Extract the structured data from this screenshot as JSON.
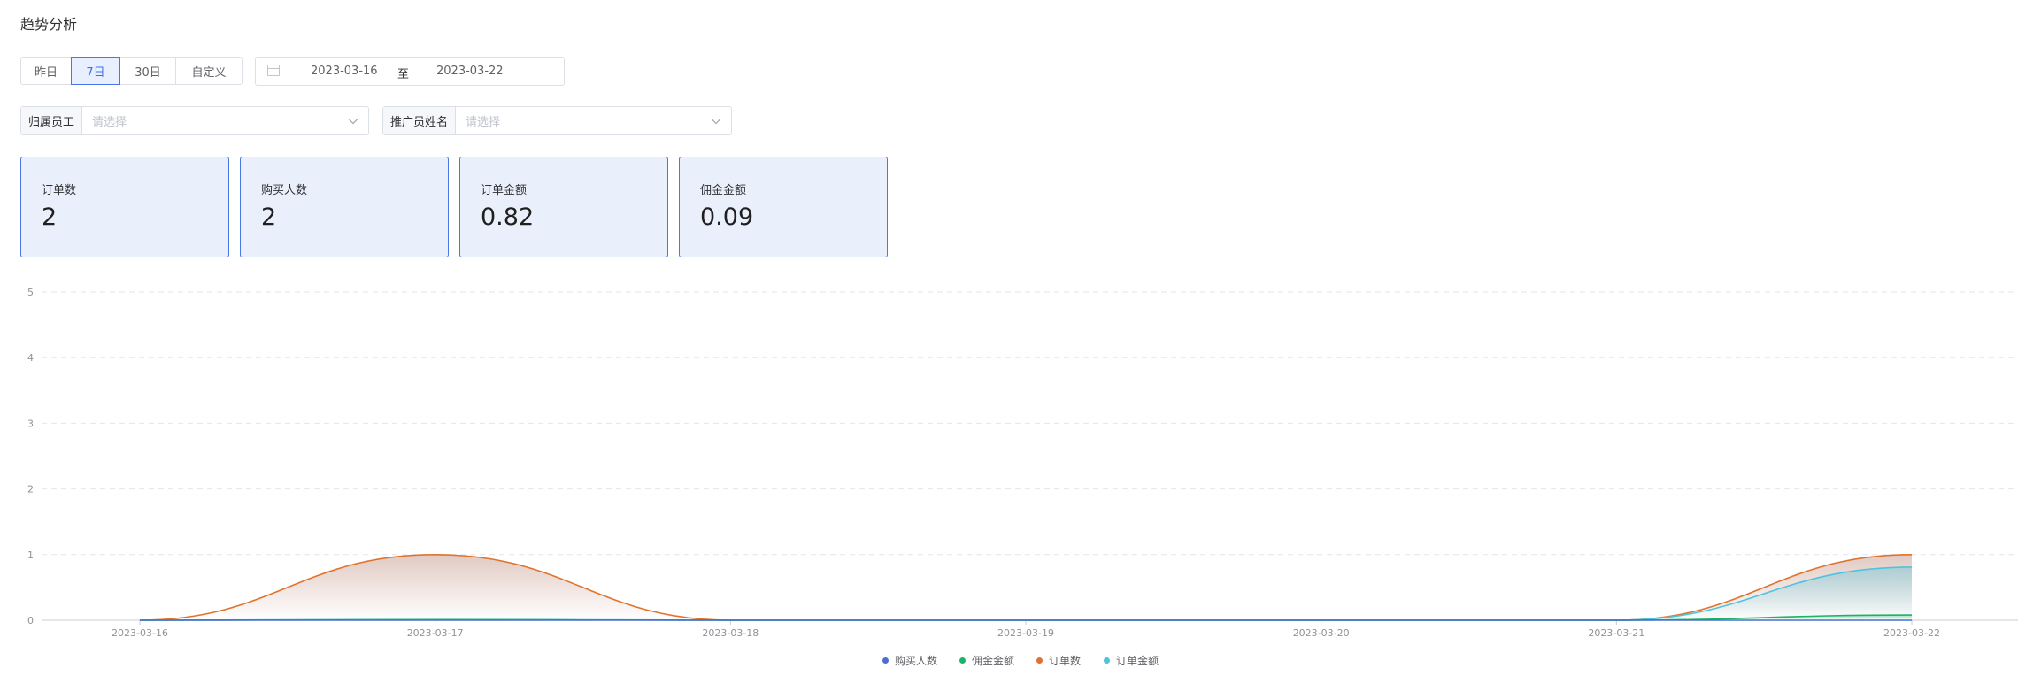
{
  "page_title": "趋势分析",
  "range_buttons": [
    "昨日",
    "7日",
    "30日",
    "自定义"
  ],
  "active_range": "7日",
  "date_range": {
    "start": "2023-03-16",
    "separator": "至",
    "end": "2023-03-22"
  },
  "filters": [
    {
      "label": "归属员工",
      "placeholder": "请选择"
    },
    {
      "label": "推广员姓名",
      "placeholder": "请选择"
    }
  ],
  "kpis": [
    {
      "label": "订单数",
      "value": "2"
    },
    {
      "label": "购买人数",
      "value": "2"
    },
    {
      "label": "订单金额",
      "value": "0.82"
    },
    {
      "label": "佣金金额",
      "value": "0.09"
    }
  ],
  "colors": {
    "accent": "#3f6fe6",
    "card_bg": "#e9effb",
    "series_buyers": "#4a6fd1",
    "series_commission": "#1bb36b",
    "series_orders": "#e0732c",
    "series_amount": "#4fc3dc"
  },
  "icons": {
    "calendar": "calendar-icon",
    "chevron": "chevron-down-icon"
  },
  "chart_data": {
    "type": "area",
    "x": [
      "2023-03-16",
      "2023-03-17",
      "2023-03-18",
      "2023-03-19",
      "2023-03-20",
      "2023-03-21",
      "2023-03-22"
    ],
    "ylim": [
      0,
      5
    ],
    "yticks": [
      0,
      1,
      2,
      3,
      4,
      5
    ],
    "grid": true,
    "smooth": true,
    "legend_position": "bottom-center",
    "series": [
      {
        "name": "购买人数",
        "values": [
          0,
          0,
          0,
          0,
          0,
          0,
          0
        ]
      },
      {
        "name": "佣金金额",
        "values": [
          0,
          0.01,
          0,
          0,
          0,
          0,
          0.08
        ]
      },
      {
        "name": "订单数",
        "values": [
          0,
          1,
          0,
          0,
          0,
          0,
          1
        ]
      },
      {
        "name": "订单金额",
        "values": [
          0,
          0.01,
          0,
          0,
          0,
          0,
          0.81
        ]
      }
    ]
  }
}
